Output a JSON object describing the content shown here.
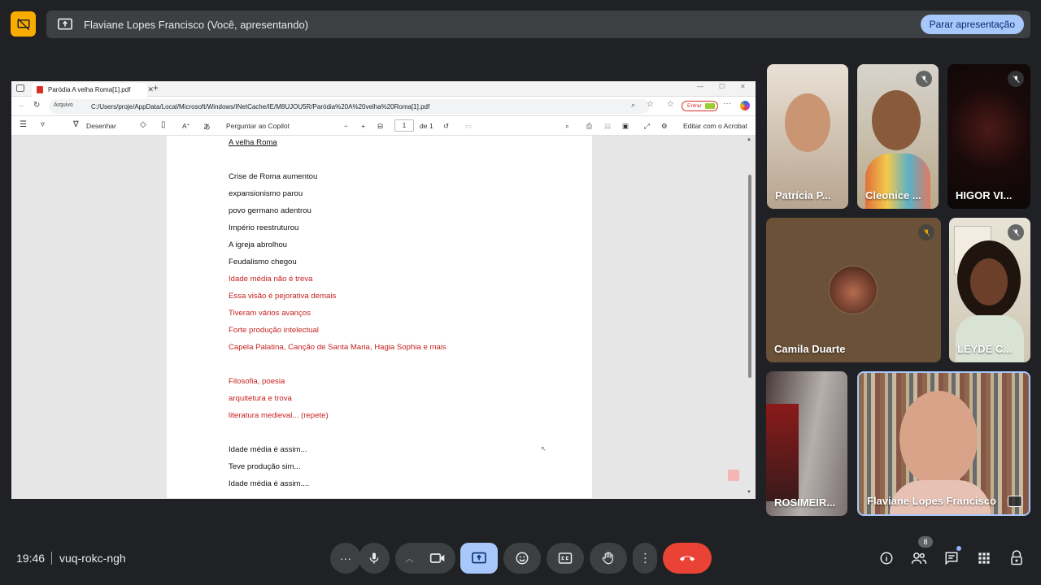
{
  "presenting": {
    "label": "Flaviane Lopes Francisco (Você, apresentando)",
    "stop_label": "Parar apresentação"
  },
  "browser": {
    "tab_title": "Paródia A velha Roma[1].pdf",
    "url_chip": "Arquivo",
    "url": "C:/Users/proje/AppData/Local/Microsoft/Windows/INetCache/IE/M8UJOU5R/Par%C3%B3dia%20A%20velha%20Roma[1].pdf",
    "url_display": "C:/Users/proje/AppData/Local/Microsoft/Windows/INetCache/IE/M8UJOU5R/Paródia%20A%20velha%20Roma[1].pdf",
    "entrar_label": "Entrar"
  },
  "pdf_toolbar": {
    "draw_label": "Desenhar",
    "copilot_label": "Perguntar ao Copilot",
    "page_number": "1",
    "page_total": "de 1",
    "acrobat_label": "Editar com o Acrobat"
  },
  "pdf_lines": [
    {
      "text": "A velha Roma",
      "style": "title"
    },
    {
      "text": "Crise de Roma aumentou",
      "style": "black"
    },
    {
      "text": "expansionismo parou",
      "style": "black"
    },
    {
      "text": "povo germano adentrou",
      "style": "black"
    },
    {
      "text": "Império reestruturou",
      "style": "black"
    },
    {
      "text": "A igreja abrolhou",
      "style": "black"
    },
    {
      "text": "Feudalismo chegou",
      "style": "black"
    },
    {
      "text": "Idade média não é treva",
      "style": "red"
    },
    {
      "text": "Essa visão é pejorativa demais",
      "style": "red"
    },
    {
      "text": "Tiveram vários avanços",
      "style": "red"
    },
    {
      "text": "Forte produção intelectual",
      "style": "red"
    },
    {
      "text": "Capela Palatina, Canção de Santa Maria, Hagia Sophia e mais",
      "style": "red"
    },
    {
      "text": "Filosofia, poesia",
      "style": "red"
    },
    {
      "text": "arquitetura e trova",
      "style": "red"
    },
    {
      "text": "literatura medieval...   (repete)",
      "style": "red"
    },
    {
      "text": "Idade média é assim...",
      "style": "black"
    },
    {
      "text": "Teve produção sim...",
      "style": "black"
    },
    {
      "text": "Idade média é assim....",
      "style": "black"
    }
  ],
  "participants": [
    {
      "name": "Patrícia P...",
      "muted": false
    },
    {
      "name": "Cleonice ...",
      "muted": true
    },
    {
      "name": "HIGOR VI...",
      "muted": true
    },
    {
      "name": "Camila Duarte",
      "muted": true
    },
    {
      "name": "LEYDE C...",
      "muted": true
    },
    {
      "name": "ROSIMEIR...",
      "muted": false
    },
    {
      "name": "Flaviane Lopes Francisco",
      "muted": false
    }
  ],
  "bottom": {
    "time": "19:46",
    "meeting_code": "vuq-rokc-ngh",
    "people_count": "8"
  },
  "colors": {
    "accent": "#a8c7fa",
    "end_call": "#ea4335",
    "presenting_badge": "#f9ab00",
    "red_text": "#c5221f"
  }
}
